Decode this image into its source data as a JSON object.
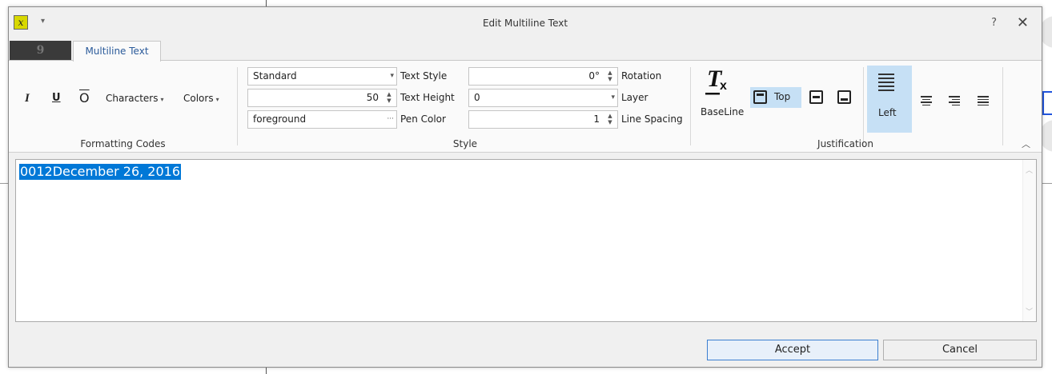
{
  "window": {
    "title": "Edit Multiline Text",
    "help": "?",
    "close": "✕",
    "app_icon_text": "x"
  },
  "tabs": {
    "file_tab": "9",
    "active_tab": "Multiline Text"
  },
  "formatting": {
    "group_label": "Formatting Codes",
    "italic": "I",
    "underline": "U",
    "overline": "O",
    "characters": "Characters",
    "colors": "Colors"
  },
  "style": {
    "group_label": "Style",
    "text_style_value": "Standard",
    "text_style_label": "Text Style",
    "text_height_value": "50",
    "text_height_label": "Text Height",
    "pen_color_value": "foreground",
    "pen_color_label": "Pen Color",
    "rotation_value": "0°",
    "rotation_label": "Rotation",
    "layer_value": "0",
    "layer_label": "Layer",
    "line_spacing_value": "1",
    "line_spacing_label": "Line Spacing",
    "browse": "···"
  },
  "justification": {
    "group_label": "Justification",
    "baseline": "BaseLine",
    "top": "Top",
    "left": "Left"
  },
  "editor": {
    "text": "0012December 26, 2016"
  },
  "buttons": {
    "accept": "Accept",
    "cancel": "Cancel"
  },
  "colors": {
    "selection": "#0078d7",
    "active_option": "#c6e0f5"
  }
}
